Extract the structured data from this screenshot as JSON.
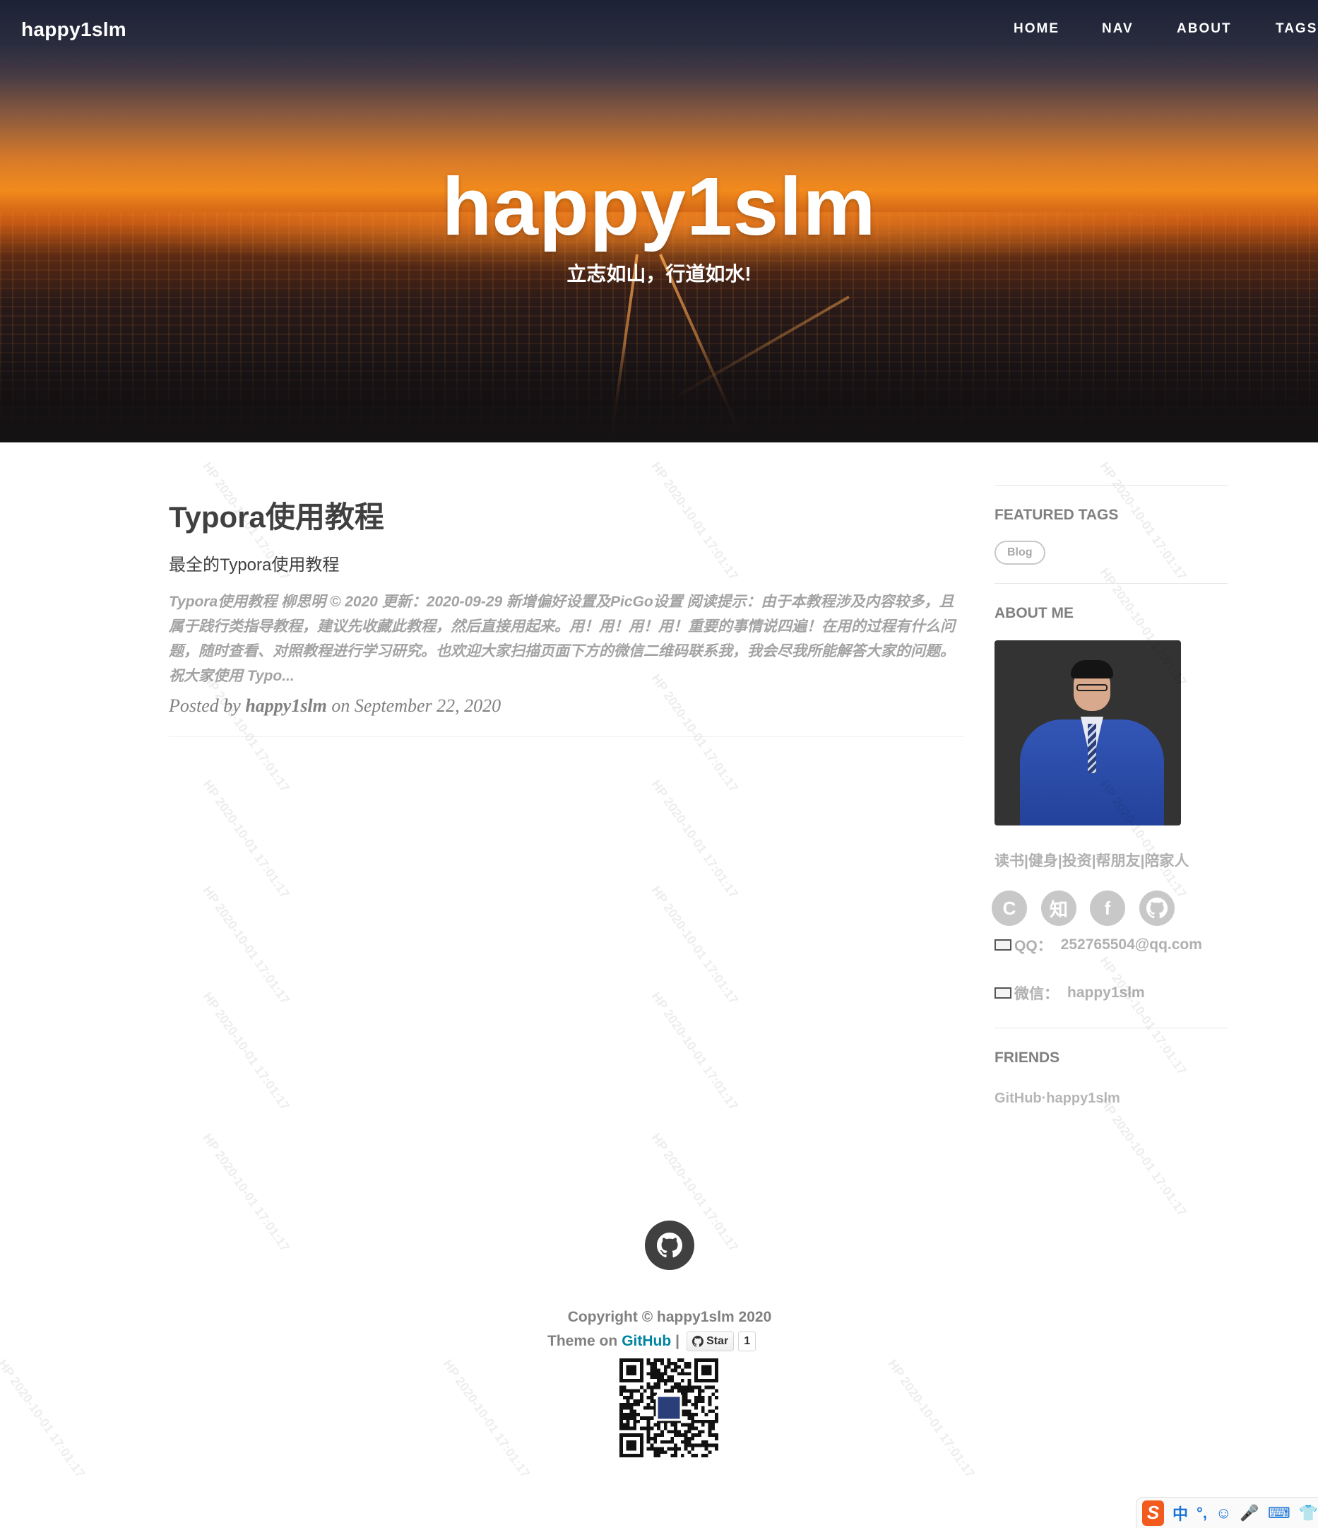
{
  "navbar": {
    "brand": "happy1slm",
    "links": [
      "HOME",
      "NAV",
      "ABOUT",
      "TAGS"
    ]
  },
  "hero": {
    "title": "happy1slm",
    "subtitle": "立志如山，行道如水!"
  },
  "post": {
    "title": "Typora使用教程",
    "subtitle": "最全的Typora使用教程",
    "excerpt": "Typora使用教程 柳思明 © 2020 更新：2020-09-29 新增偏好设置及PicGo设置 阅读提示：由于本教程涉及内容较多，且属于践行类指导教程，建议先收藏此教程，然后直接用起来。用！用！用！用！重要的事情说四遍！在用的过程有什么问题，随时查看、对照教程进行学习研究。也欢迎大家扫描页面下方的微信二维码联系我，我会尽我所能解答大家的问题。祝大家使用 Typo...",
    "meta": {
      "prefix": "Posted by",
      "author": "happy1slm",
      "on": "on",
      "date": "September 22, 2020"
    }
  },
  "sidebar": {
    "featured_tags_heading": "FEATURED TAGS",
    "tags": [
      "Blog"
    ],
    "about_heading": "ABOUT ME",
    "motto": "读书|健身|投资|帮朋友|陪家人",
    "social": [
      {
        "icon": "csdn-icon",
        "glyph": "C"
      },
      {
        "icon": "zhihu-icon",
        "glyph": "知"
      },
      {
        "icon": "facebook-icon",
        "glyph": "f"
      },
      {
        "icon": "github-icon",
        "glyph": ""
      }
    ],
    "qq": {
      "label": "QQ：",
      "value": "252765504@qq.com"
    },
    "wechat": {
      "label": "微信：",
      "value": "happy1slm"
    },
    "friends_heading": "FRIENDS",
    "friends": [
      "GitHub·happy1slm"
    ]
  },
  "footer": {
    "copyright": "Copyright © happy1slm 2020",
    "theme_prefix": "Theme on",
    "theme_link": "GitHub",
    "separator": "|",
    "star_label": "Star",
    "star_count": "1"
  },
  "watermark": {
    "line1": "HP",
    "line2": "2020-10-01 17:01:17"
  },
  "ime": {
    "logo": "S",
    "items": [
      "中",
      "°,",
      "☺",
      "🎤",
      "⌨",
      "👕"
    ]
  },
  "colors": {
    "text": "#404040",
    "muted": "#808080",
    "link": "#0085a1",
    "ime_accent": "#f25a1e"
  }
}
